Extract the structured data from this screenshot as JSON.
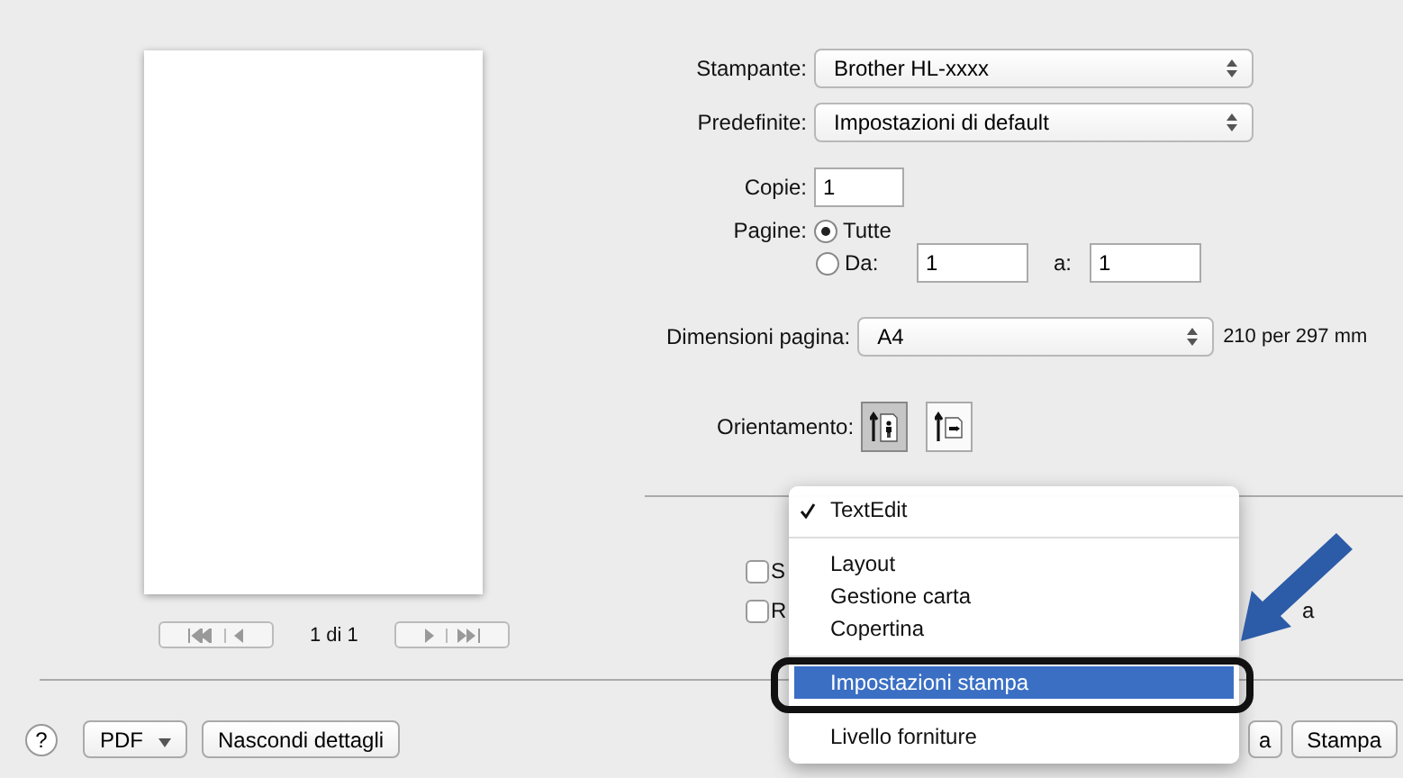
{
  "preview": {
    "page_indicator": "1 di 1"
  },
  "printer": {
    "label": "Stampante:",
    "value": "Brother HL-xxxx"
  },
  "presets": {
    "label": "Predefinite:",
    "value": "Impostazioni di default"
  },
  "copies": {
    "label": "Copie:",
    "value": "1"
  },
  "pages": {
    "label": "Pagine:",
    "options": [
      {
        "label": "Tutte",
        "selected": true
      },
      {
        "label": "Da:",
        "selected": false
      }
    ],
    "from": "1",
    "to_label": "a:",
    "to": "1"
  },
  "paper_size": {
    "label": "Dimensioni pagina:",
    "value": "A4",
    "note": "210 per 297 mm"
  },
  "orientation": {
    "label": "Orientamento:",
    "options": [
      {
        "kind": "portrait",
        "selected": true
      },
      {
        "kind": "landscape",
        "selected": false
      }
    ]
  },
  "checkboxes": [
    {
      "label": "S",
      "checked": false
    },
    {
      "label": "R",
      "trailing": "a",
      "checked": false
    }
  ],
  "menu": {
    "items": [
      {
        "kind": "item",
        "label": "TextEdit",
        "checked": true,
        "selected": false
      },
      {
        "kind": "separator"
      },
      {
        "kind": "item",
        "label": "Layout",
        "checked": false,
        "selected": false
      },
      {
        "kind": "item",
        "label": "Gestione carta",
        "checked": false,
        "selected": false
      },
      {
        "kind": "item",
        "label": "Copertina",
        "checked": false,
        "selected": false
      },
      {
        "kind": "separator"
      },
      {
        "kind": "item",
        "label": "Impostazioni stampa",
        "checked": false,
        "selected": true
      },
      {
        "kind": "separator"
      },
      {
        "kind": "item",
        "label": "Livello forniture",
        "checked": false,
        "selected": false
      }
    ]
  },
  "footer": {
    "help": "?",
    "pdf": "PDF",
    "details": "Nascondi dettagli",
    "cancel": "a",
    "print": "Stampa"
  }
}
